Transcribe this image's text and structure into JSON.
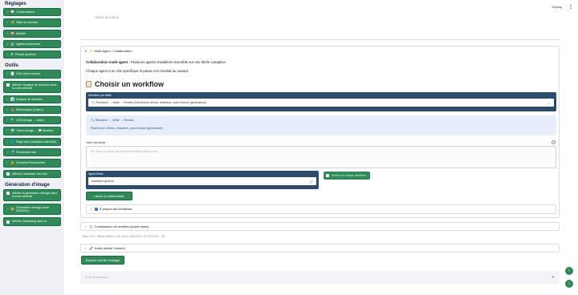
{
  "sidebar": {
    "sections": {
      "settings": "Réglages",
      "tools": "Outils",
      "image_gen": "Génération d'image"
    },
    "settings_items": [
      {
        "label": "Conversations",
        "icon": "speech-bubble-icon"
      },
      {
        "label": "Style de réponse",
        "icon": "sparkle-icon"
      },
      {
        "label": "Modèle",
        "icon": "brain-icon"
      },
      {
        "label": "Agents autonomes",
        "icon": "robot-icon"
      },
      {
        "label": "Prompt système",
        "icon": "gear-icon"
      }
    ],
    "tools_items": [
      {
        "label": "RAG (docs locaux)",
        "type": "button",
        "icon": "document-icon"
      },
      {
        "label": "Afficher l'analyse de données dans la zone centrale",
        "type": "checkbox"
      },
      {
        "label": "Analyse de données",
        "type": "button",
        "icon": "chart-icon"
      },
      {
        "label": "Bibliothèque (Zotero)",
        "type": "button",
        "icon": "book-icon"
      },
      {
        "label": "OCR (image → texte)",
        "type": "button",
        "icon": "scan-icon"
      },
      {
        "label": "Vision (image → 💬 Modèle)",
        "type": "button",
        "icon": "eye-icon"
      },
      {
        "label": "Page web (validation manuelle)",
        "type": "button",
        "icon": "globe-icon"
      },
      {
        "label": "Recherche web",
        "type": "button",
        "icon": "search-icon"
      },
      {
        "label": "Données Personnelles",
        "type": "button",
        "icon": "lock-icon"
      },
      {
        "label": "Afficher l'Assistant YouTube",
        "type": "checkbox"
      }
    ],
    "image_items": [
      {
        "label": "Afficher la génération d'image dans la zone centrale",
        "type": "checkbox"
      },
      {
        "label": "Génération d'image (local SD/SDXL)",
        "type": "button",
        "icon": "palette-icon"
      },
      {
        "label": "Afficher l'inpainting dans la",
        "type": "checkbox"
      }
    ]
  },
  "header": {
    "deploy": "Deploy",
    "menu_icon": "kebab-menu-icon"
  },
  "timestamp": "2025-01-18 23:48:06",
  "collab": {
    "expander_label": "Multi-Agent / Collaboration",
    "intro_bold": "Collaboration multi-agent :",
    "intro_rest": " Plusieurs agents travaillent ensemble sur une tâche complexe.",
    "intro_line2": "Chaque agent a un rôle spécifique et passe son résultat au suivant.",
    "choose_title": "Choisir un workflow",
    "workflow_label": "Workflow pré-défini",
    "workflow_value": "🔍 Research → Write → Review (Recherche d'infos, rédaction, puis révision (générative))",
    "info_title": "🔍 Research → Write → Review",
    "info_desc": "Recherche d'infos, rédaction, puis révision (générative)",
    "request_label": "Votre demande",
    "request_placeholder": "Ex: Écris un article sur l'écriture inclusive dans la vie",
    "agent_label": "Agent Writer",
    "agent_value": "Assistant général",
    "agent_icon": "📝",
    "toggle_label": "Afficher les étapes détaillées",
    "launch_label": "Lancer la collaboration",
    "about_label": "À propos des workflows"
  },
  "compare": {
    "label": "Comparaison de modèles (power users)",
    "icon": "⚖️"
  },
  "meta": "Stats • 5.7k · tokens utilisés • 5 sn, envoi • 265-2025 • 29 Ts PS 40 s , UIC",
  "audio": {
    "label": "Audio (dictée / lecture)",
    "icon": "🎤"
  },
  "export_label": "Exporter dernier échange",
  "chat": {
    "placeholder": "Pose ta question !"
  }
}
